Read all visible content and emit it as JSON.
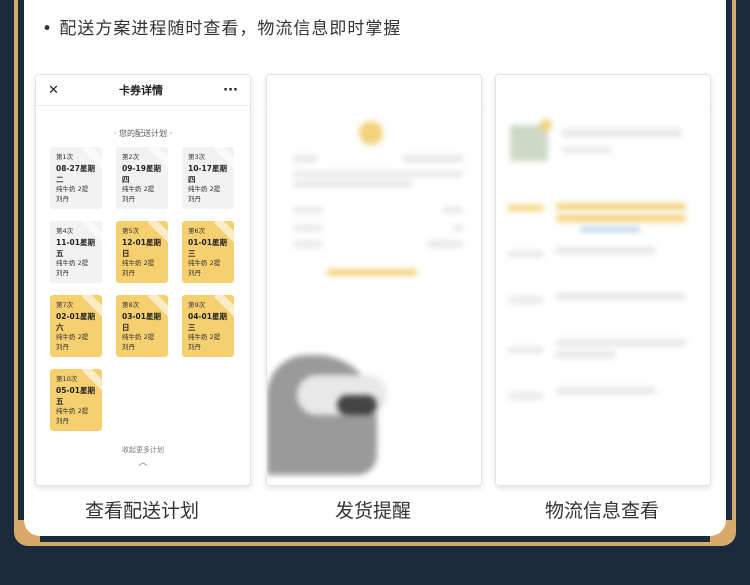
{
  "headline": "• 配送方案进程随时查看，物流信息即时掌握",
  "phone1": {
    "title": "卡券详情",
    "close_icon": "✕",
    "more_icon": "···",
    "plan_title": "· 您的配送计划 ·",
    "cards": [
      {
        "no": "第1次",
        "date": "08-27星期二",
        "item": "纯牛奶 2提",
        "name": "刘丹",
        "style": "grey"
      },
      {
        "no": "第2次",
        "date": "09-19星期四",
        "item": "纯牛奶 2提",
        "name": "刘丹",
        "style": "grey"
      },
      {
        "no": "第3次",
        "date": "10-17星期四",
        "item": "纯牛奶 2提",
        "name": "刘丹",
        "style": "grey"
      },
      {
        "no": "第4次",
        "date": "11-01星期五",
        "item": "纯牛奶 2提",
        "name": "刘丹",
        "style": "grey"
      },
      {
        "no": "第5次",
        "date": "12-01星期日",
        "item": "纯牛奶 2提",
        "name": "刘丹",
        "style": "gold"
      },
      {
        "no": "第6次",
        "date": "01-01星期三",
        "item": "纯牛奶 2提",
        "name": "刘丹",
        "style": "gold"
      },
      {
        "no": "第7次",
        "date": "02-01星期六",
        "item": "纯牛奶 2提",
        "name": "刘丹",
        "style": "gold"
      },
      {
        "no": "第8次",
        "date": "03-01星期日",
        "item": "纯牛奶 2提",
        "name": "刘丹",
        "style": "gold"
      },
      {
        "no": "第9次",
        "date": "04-01星期三",
        "item": "纯牛奶 2提",
        "name": "刘丹",
        "style": "gold"
      },
      {
        "no": "第10次",
        "date": "05-01星期五",
        "item": "纯牛奶 2提",
        "name": "刘丹",
        "style": "gold"
      }
    ],
    "more_text": "收起更多计划",
    "chevron": "︿"
  },
  "captions": {
    "c1": "查看配送计划",
    "c2": "发货提醒",
    "c3": "物流信息查看"
  },
  "colors": {
    "gold": "#d9a96a",
    "card_gold": "#f6cf6f",
    "background": "#1c2a3d"
  }
}
